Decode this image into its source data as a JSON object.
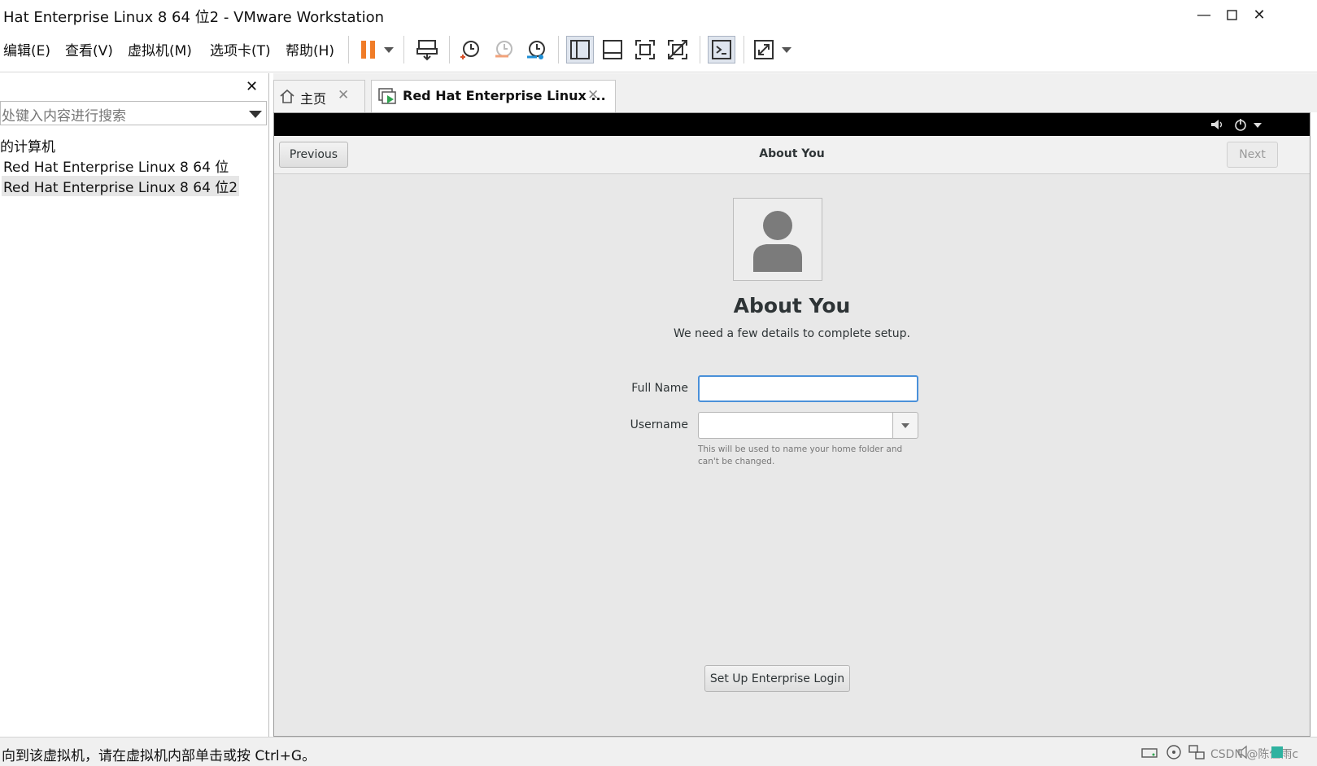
{
  "window": {
    "title": "Hat Enterprise Linux 8 64 位2 - VMware Workstation",
    "controls": [
      "minimize",
      "maximize",
      "close"
    ]
  },
  "menubar": {
    "items": [
      "编辑(E)",
      "查看(V)",
      "虚拟机(M)",
      "选项卡(T)",
      "帮助(H)"
    ]
  },
  "toolbar": {
    "icons": [
      "pause-icon",
      "send-ctrl-alt-del-icon",
      "snapshot-take-icon",
      "snapshot-revert-icon",
      "snapshot-manager-icon",
      "library-view-icon",
      "thumbnail-bar-icon",
      "fullscreen-icon",
      "unity-icon",
      "console-icon",
      "stretch-icon"
    ],
    "accent": "#f07c28",
    "snapshot_blue": "#1e8fd6"
  },
  "library": {
    "search_placeholder": "处键入内容进行搜索",
    "root_label": "的计算机",
    "items": [
      "Red Hat Enterprise Linux 8 64 位",
      "Red Hat Enterprise Linux 8 64 位2"
    ]
  },
  "tabs": [
    {
      "label": "主页",
      "icon": "home-icon"
    },
    {
      "label": "Red Hat Enterprise Linux ...",
      "icon": "vm-running-icon"
    }
  ],
  "vm": {
    "header": {
      "previous": "Previous",
      "title": "About You",
      "next": "Next"
    },
    "page_title": "About You",
    "page_subtitle": "We need a few details to complete setup.",
    "full_name_label": "Full Name",
    "full_name_value": "",
    "username_label": "Username",
    "username_value": "",
    "hint": "This will be used to name your home folder and can't be changed.",
    "enterprise_login": "Set Up Enterprise Login"
  },
  "statusbar": {
    "text": "向到该虚拟机，请在虚拟机内部单击或按 Ctrl+G。",
    "watermark": "CSDN @陈佳雨c"
  }
}
